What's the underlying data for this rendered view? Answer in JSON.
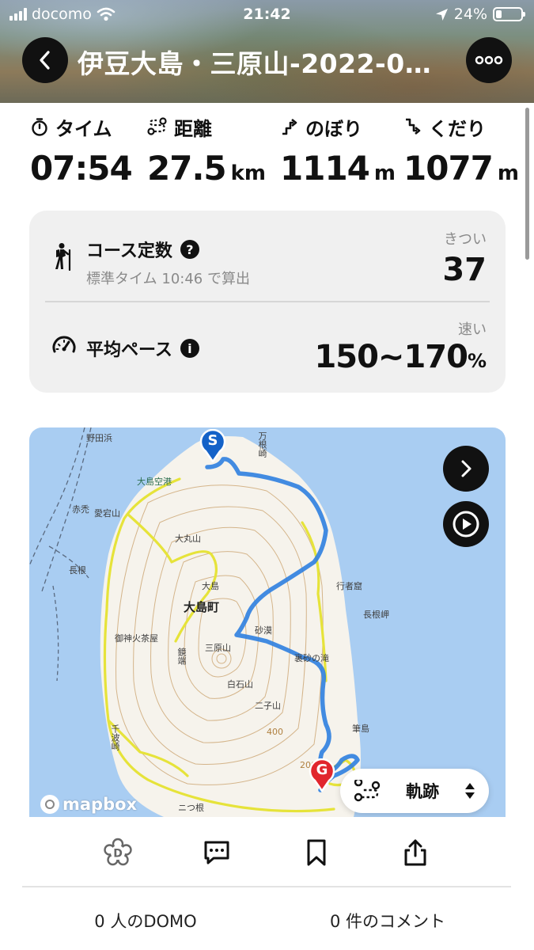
{
  "status_bar": {
    "carrier": "docomo",
    "time": "21:42",
    "battery": "24%",
    "battery_level": 0.24
  },
  "header": {
    "title": "伊豆大島・三原山-2022-04...",
    "back_icon": "chevron-left-icon",
    "more_icon": "more-icon"
  },
  "stats": [
    {
      "label": "タイム",
      "value": "07:54",
      "unit": "",
      "icon": "stopwatch-icon"
    },
    {
      "label": "距離",
      "value": "27.5",
      "unit": "km",
      "icon": "route-icon"
    },
    {
      "label": "のぼり",
      "value": "1114",
      "unit": "m",
      "icon": "ascent-icon"
    },
    {
      "label": "くだり",
      "value": "1077",
      "unit": "m",
      "icon": "descent-icon"
    }
  ],
  "course_constant": {
    "title": "コース定数",
    "subtitle": "標準タイム 10:46 で算出",
    "caption": "きつい",
    "value": "37",
    "help": "?"
  },
  "average_pace": {
    "title": "平均ペース",
    "caption": "速い",
    "value": "150~170",
    "unit": "%",
    "info": "i"
  },
  "map": {
    "start_marker": "S",
    "goal_marker": "G",
    "attribution": "mapbox",
    "track_selector": "軌跡",
    "labels": {
      "nodahama": "野田浜",
      "manezaki": "万根崎",
      "airport": "大島空港",
      "akage": "赤禿",
      "atagoyama": "愛宕山",
      "omaruyama": "大丸山",
      "nagane": "長根",
      "ojima_hill": "大島",
      "oshima_town": "大島町",
      "gyojanoiwaya": "行者窟",
      "naganemisaki": "長根岬",
      "sabaku": "砂漠",
      "kamijinjaya": "御神火茶屋",
      "kagamibata": "鏡端",
      "miharayama": "三原山",
      "urano_taki": "裏砂の滝",
      "shiroishiyama": "白石山",
      "futagoyama": "二子山",
      "fudejima": "筆島",
      "senbazaki": "千波崎",
      "futatsune": "ニつ根",
      "contour_400": "400",
      "contour_200": "200"
    }
  },
  "actions": {
    "domo_icon": "domo-flower-icon",
    "comment_icon": "comment-icon",
    "bookmark_icon": "bookmark-icon",
    "share_icon": "share-icon"
  },
  "counts": {
    "domo": "0 人のDOMO",
    "comments": "0 件のコメント"
  }
}
